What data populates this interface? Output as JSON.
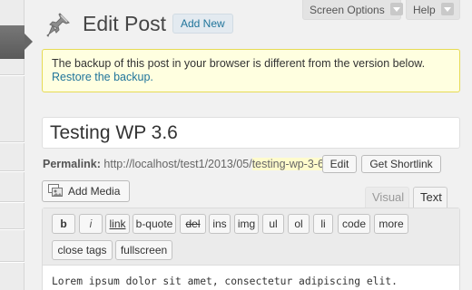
{
  "screen_meta": {
    "options_label": "Screen Options",
    "help_label": "Help"
  },
  "header": {
    "title": "Edit Post",
    "add_new_label": "Add New"
  },
  "notice": {
    "message": "The backup of this post in your browser is different from the version below.",
    "restore_link": "Restore the backup."
  },
  "post": {
    "title": "Testing WP 3.6"
  },
  "permalink": {
    "label": "Permalink:",
    "base": " http://localhost/test1/2013/05/",
    "slug": "testing-wp-3-6",
    "trailing": "/",
    "edit_label": "Edit",
    "shortlink_label": "Get Shortlink"
  },
  "media": {
    "add_media_label": "Add Media"
  },
  "editor": {
    "tabs": {
      "visual": "Visual",
      "text": "Text"
    },
    "quicktags": [
      "b",
      "i",
      "link",
      "b-quote",
      "del",
      "ins",
      "img",
      "ul",
      "ol",
      "li",
      "code",
      "more",
      "close tags",
      "fullscreen"
    ],
    "content": "Lorem ipsum dolor sit amet, consectetur adipiscing elit."
  },
  "colors": {
    "link": "#21759b",
    "notice_bg": "#ffffe0",
    "notice_border": "#e6db55",
    "slug_highlight": "#fffbcc"
  }
}
